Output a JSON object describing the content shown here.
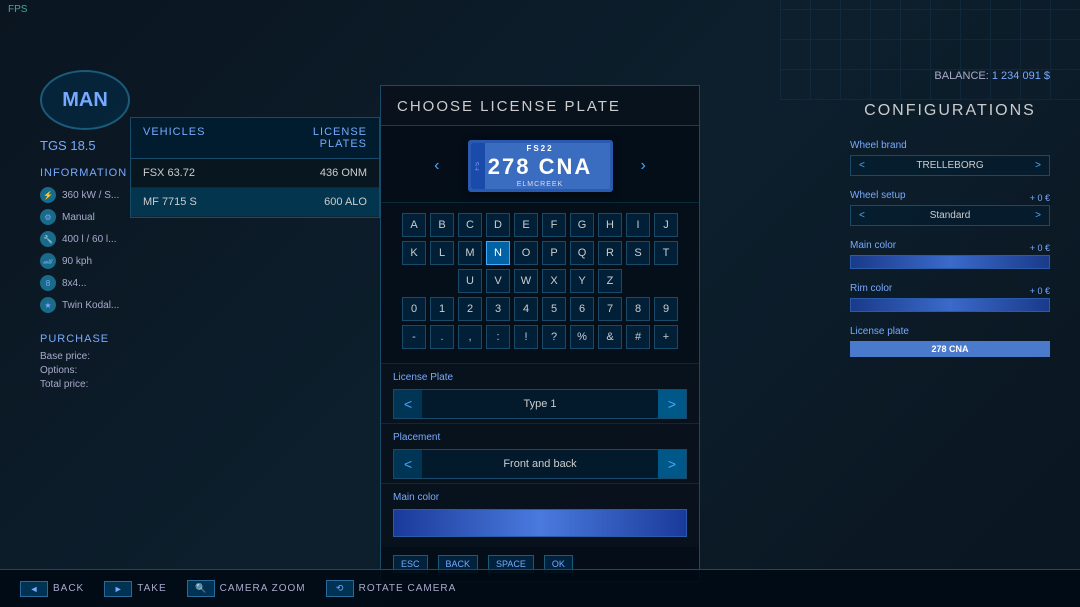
{
  "fps": "FPS",
  "balance": {
    "label": "BALANCE:",
    "amount": "1 234 091 $"
  },
  "left": {
    "logo": "MAN",
    "model": "TGS 18.5",
    "info_label": "INFORMATION",
    "specs": [
      {
        "icon": "⚡",
        "text": "360 kW / S..."
      },
      {
        "icon": "⚙",
        "text": "Manual"
      },
      {
        "icon": "🔧",
        "text": "400 l / 60 l..."
      },
      {
        "icon": "🏎",
        "text": "90 kph"
      },
      {
        "icon": "8",
        "text": "8x4..."
      },
      {
        "icon": "★",
        "text": "Twin Kodal..."
      }
    ],
    "purchase_label": "PURCHASE",
    "prices": [
      {
        "label": "Base price:",
        "value": "..."
      },
      {
        "label": "Options:",
        "value": "..."
      },
      {
        "label": "Total price:",
        "value": "..."
      }
    ]
  },
  "vehicle_list": {
    "col_vehicles": "VEHICLES",
    "col_plates": "LICENSE PLATES",
    "rows": [
      {
        "name": "FSX 63.72",
        "plate": "436 ONM",
        "selected": false
      },
      {
        "name": "MF 7715 S",
        "plate": "600 ALO",
        "selected": true
      }
    ]
  },
  "right_panel": {
    "title": "CONFIGURATIONS",
    "sections": [
      {
        "label": "Wheel brand",
        "left_arrow": "<",
        "value": "TRELLEBORG",
        "right_arrow": ">",
        "price": ""
      },
      {
        "label": "Wheel setup",
        "left_arrow": "<",
        "value": "Standard",
        "right_arrow": ">",
        "price": "+ 0 €"
      },
      {
        "label": "Main color",
        "left_arrow": "<",
        "value": "",
        "right_arrow": ">",
        "price": "+ 0 €",
        "type": "color"
      },
      {
        "label": "Rim color",
        "left_arrow": "<",
        "value": "",
        "right_arrow": ">",
        "price": "+ 0 €",
        "type": "color"
      },
      {
        "label": "License plate",
        "left_arrow": "<",
        "value": "278 CNA",
        "right_arrow": ">",
        "type": "plate"
      }
    ]
  },
  "modal": {
    "title": "CHOOSE LICENSE PLATE",
    "plate": {
      "top": "FS22",
      "main": "278 CNA",
      "bottom": "ELMCREEK",
      "stripe": "FS"
    },
    "keyboard": {
      "rows": [
        [
          "A",
          "B",
          "C",
          "D",
          "E",
          "F",
          "G",
          "H",
          "I",
          "J"
        ],
        [
          "K",
          "L",
          "M",
          "N",
          "O",
          "P",
          "Q",
          "R",
          "S",
          "T"
        ],
        [
          "U",
          "V",
          "W",
          "X",
          "Y",
          "Z"
        ],
        [
          "0",
          "1",
          "2",
          "3",
          "4",
          "5",
          "6",
          "7",
          "8",
          "9"
        ],
        [
          "-",
          ".",
          ",",
          ":",
          " !",
          " ?",
          "%",
          "&",
          "#",
          "+"
        ]
      ],
      "active_key": "N"
    },
    "license_plate_type": {
      "label": "License Plate",
      "value": "Type 1",
      "left_arrow": "<",
      "right_arrow": ">"
    },
    "placement": {
      "label": "Placement",
      "value": "Front and back",
      "left_arrow": "<",
      "right_arrow": ">"
    },
    "main_color": {
      "label": "Main color"
    },
    "buttons": [
      {
        "key": "ESC",
        "label": ""
      },
      {
        "key": "BACK",
        "label": ""
      },
      {
        "key": "SPACE",
        "label": ""
      },
      {
        "key": "OK",
        "label": ""
      }
    ]
  },
  "bottom_bar": {
    "buttons": [
      {
        "key": "◄",
        "label": "BACK"
      },
      {
        "key": "►",
        "label": "TAKE"
      },
      {
        "key": "◄►",
        "label": "CAMERA ZOOM"
      },
      {
        "key": "⟲",
        "label": "ROTATE CAMERA"
      }
    ]
  }
}
